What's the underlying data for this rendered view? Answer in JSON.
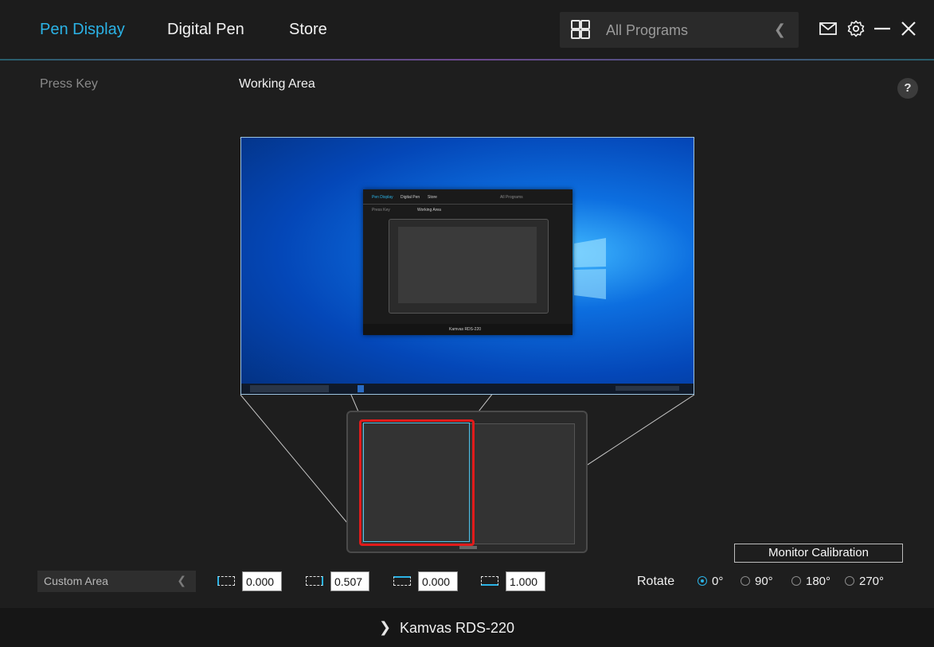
{
  "nav": {
    "tabs": [
      {
        "label": "Pen Display",
        "active": true
      },
      {
        "label": "Digital Pen",
        "active": false
      },
      {
        "label": "Store",
        "active": false
      }
    ],
    "programs_label": "All Programs",
    "programs_icon": "grid-icon"
  },
  "window_controls": [
    "mail-icon",
    "gear-icon",
    "minimize-icon",
    "close-icon"
  ],
  "subtabs": [
    {
      "label": "Press Key",
      "active": false
    },
    {
      "label": "Working Area",
      "active": true
    }
  ],
  "help_label": "?",
  "preview": {
    "mini_app": {
      "tabs": [
        "Pen Display",
        "Digital Pen",
        "Store"
      ],
      "programs_label": "All Programs",
      "subtabs": [
        "Press Key",
        "Working Area"
      ],
      "device": "Kamvas RDS-220"
    }
  },
  "area": {
    "mode": "Custom Area",
    "values": [
      "0.000",
      "0.507",
      "0.000",
      "1.000"
    ]
  },
  "calibration_label": "Monitor Calibration",
  "rotate": {
    "label": "Rotate",
    "options": [
      "0°",
      "90°",
      "180°",
      "270°"
    ],
    "selected": "0°"
  },
  "device_name": "Kamvas RDS-220",
  "colors": {
    "accent": "#2bb3e6",
    "highlight": "#e21b1b",
    "background": "#1e1e1e"
  }
}
